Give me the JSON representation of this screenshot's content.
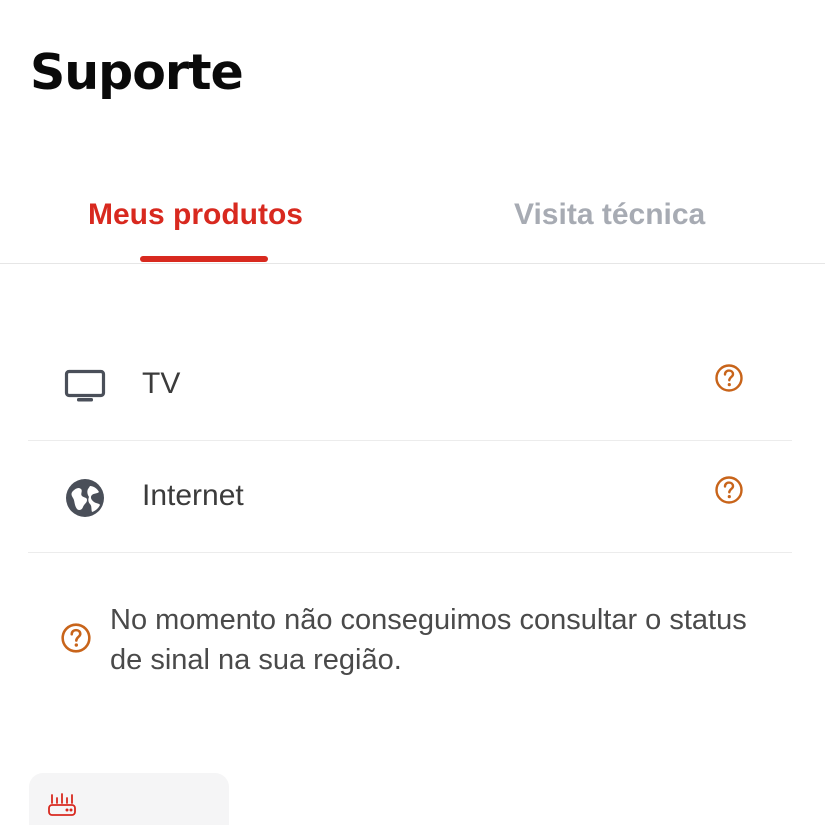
{
  "page": {
    "title": "Suporte"
  },
  "tabs": [
    {
      "label": "Meus produtos",
      "active": true
    },
    {
      "label": "Visita técnica",
      "active": false
    }
  ],
  "products": [
    {
      "label": "TV",
      "icon": "tv-icon"
    },
    {
      "label": "Internet",
      "icon": "globe-icon"
    }
  ],
  "notice": {
    "icon": "help-circle-icon",
    "text": "No momento não conseguimos consultar o status de sinal na sua região."
  },
  "equipment_card": {
    "icon": "router-icon"
  },
  "colors": {
    "accent": "#d8291f",
    "help_icon": "#c8641a",
    "inactive_tab": "#a7abb3",
    "icon_gray": "#4a4f59"
  }
}
